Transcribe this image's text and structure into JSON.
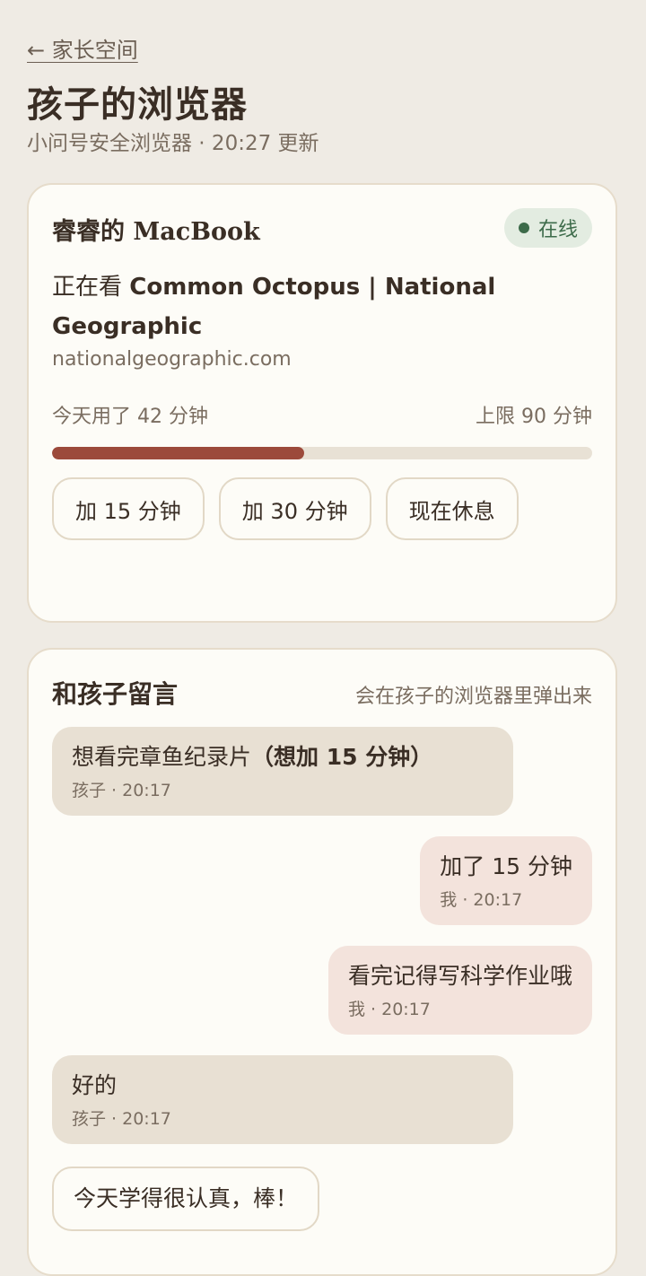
{
  "header": {
    "back_label": "← 家长空间",
    "title": "孩子的浏览器",
    "subtitle": "小问号安全浏览器 · 20:27 更新"
  },
  "device": {
    "name": "睿睿的 MacBook",
    "status": "在线",
    "watching_prefix": "正在看 ",
    "watching_title": "Common Octopus | National Geographic",
    "domain": "nationalgeographic.com",
    "used_label": "今天用了 42 分钟",
    "limit_label": "上限 90 分钟",
    "used_fraction": 0.467,
    "actions": [
      "加 15 分钟",
      "加 30 分钟",
      "现在休息"
    ]
  },
  "messages": {
    "title": "和孩子留言",
    "hint": "会在孩子的浏览器里弹出来",
    "items": [
      {
        "text": "想看完章鱼纪录片",
        "bold": "（想加 15 分钟）",
        "meta": "孩子 · 20:17"
      },
      {
        "text": "加了 15 分钟",
        "meta": "我 · 20:17"
      },
      {
        "text": "看完记得写科学作业哦",
        "meta": "我 · 20:17"
      },
      {
        "text": "好的",
        "meta": "孩子 · 20:17"
      },
      {
        "text": "今天学得很认真，棒！"
      }
    ]
  },
  "colors": {
    "accent": "#9c4a3b",
    "online": "#3d6b4a",
    "kid_bubble": "#e8e0d3",
    "parent_bubble": "#f3e3dc"
  }
}
